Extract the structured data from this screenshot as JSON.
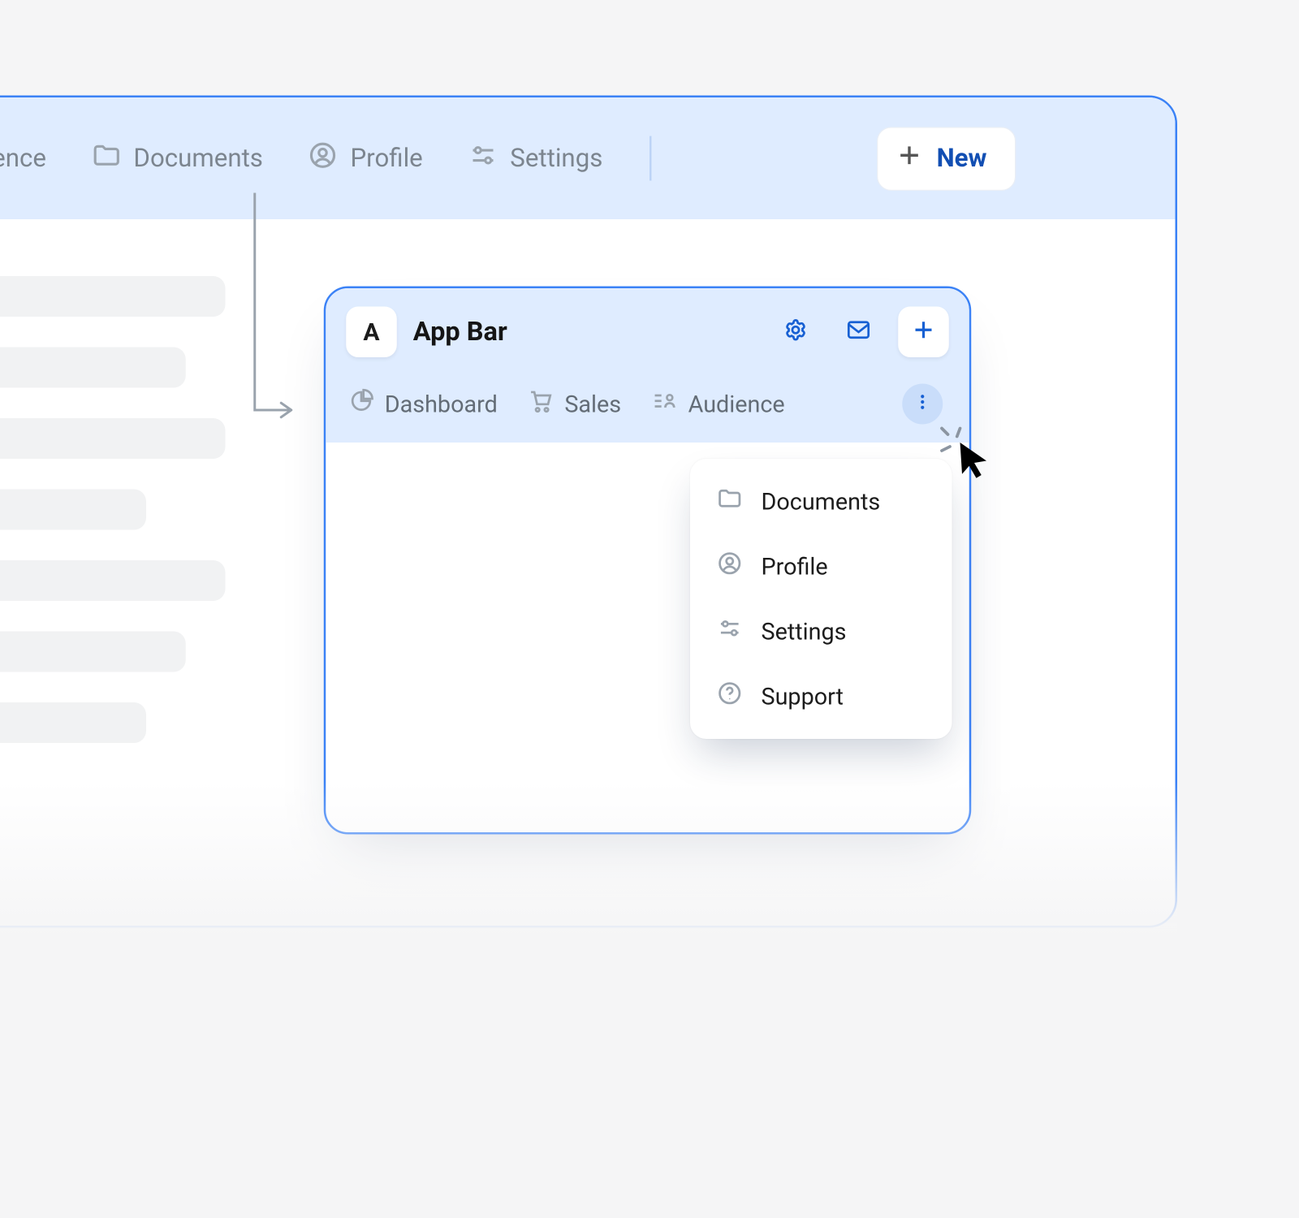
{
  "bigWindow": {
    "nav": {
      "audience": "Audience",
      "documents": "Documents",
      "profile": "Profile",
      "settings": "Settings"
    },
    "newButton": "New"
  },
  "smallWindow": {
    "appLetter": "A",
    "title": "App Bar",
    "tabs": {
      "dashboard": "Dashboard",
      "sales": "Sales",
      "audience": "Audience"
    }
  },
  "dropdown": {
    "documents": "Documents",
    "profile": "Profile",
    "settings": "Settings",
    "support": "Support"
  }
}
